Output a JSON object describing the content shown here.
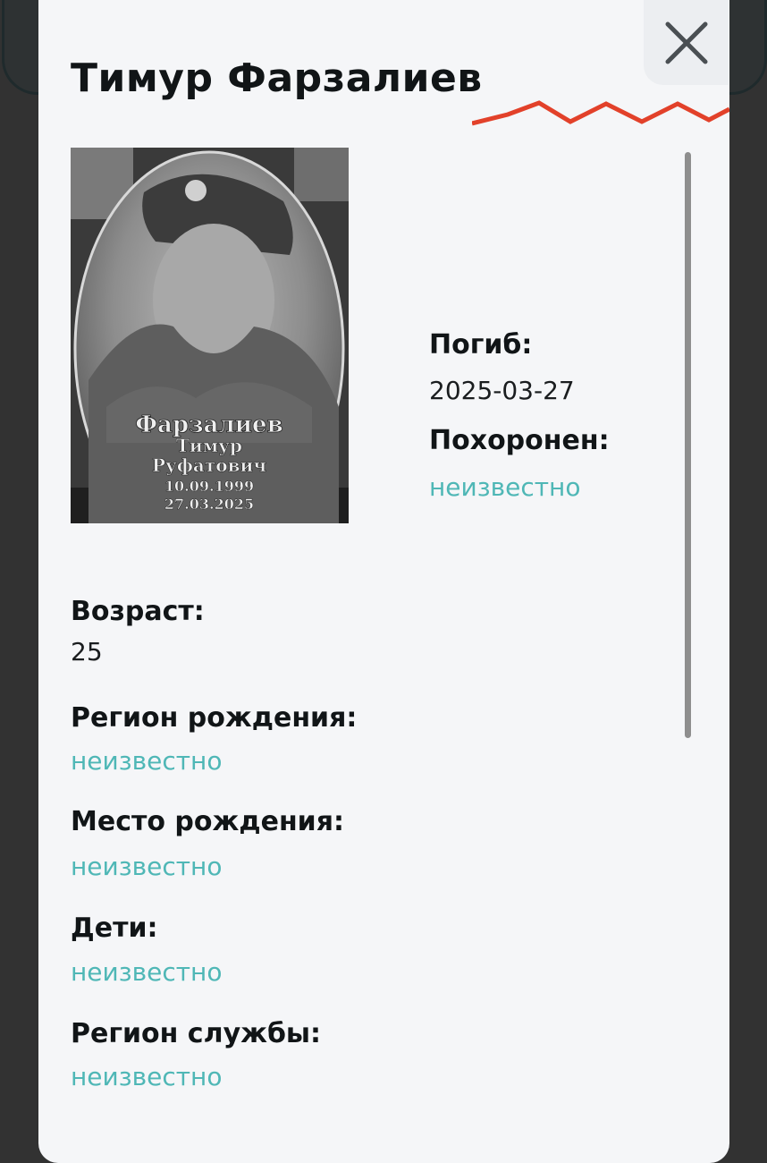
{
  "profile": {
    "name": "Тимур Фарзалиев",
    "photo_caption": {
      "surname": "Фарзалиев",
      "name": "Тимур",
      "patronymic": "Руфатович",
      "birth": "10.09.1999",
      "death": "27.03.2025"
    }
  },
  "fields": {
    "died": {
      "label": "Погиб:",
      "value": "2025-03-27"
    },
    "buried": {
      "label": "Похоронен:",
      "value": "неизвестно"
    },
    "age": {
      "label": "Возраст:",
      "value": "25"
    },
    "birth_region": {
      "label": "Регион рождения:",
      "value": "неизвестно"
    },
    "birth_place": {
      "label": "Место рождения:",
      "value": "неизвестно"
    },
    "children": {
      "label": "Дети:",
      "value": "неизвестно"
    },
    "service_region": {
      "label": "Регион службы:",
      "value": "неизвестно"
    }
  },
  "icons": {
    "close": "close-icon",
    "decoration": "zigzag-icon"
  },
  "colors": {
    "accent_zigzag": "#e2412a",
    "unknown_value": "#4fb7b6",
    "modal_bg": "#f5f6f8"
  }
}
